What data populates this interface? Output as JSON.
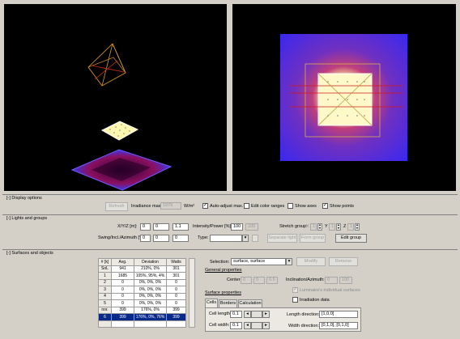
{
  "display_options": {
    "header": "[-] Display options",
    "refresh_label": "Refresh",
    "irradiance_label": "Irradiance max.:",
    "irradiance_value": "1979",
    "irradiance_unit": "W/m²",
    "auto_adjust": {
      "label": "Auto-adjust max.",
      "checked": true
    },
    "edit_color_ranges": {
      "label": "Edit color ranges",
      "checked": false
    },
    "show_axes": {
      "label": "Show axes",
      "checked": false
    },
    "show_points": {
      "label": "Show points",
      "checked": true
    }
  },
  "lights": {
    "header": "[-] Lights and groups",
    "xyz_label": "X/Y/Z [m]:",
    "xyz_values": [
      "0",
      "0",
      "1.1"
    ],
    "intensity_label": "Intensity/Power [%]:",
    "intensity_value": "100",
    "intensity_extra": "100",
    "swing_label": "Swing/Incl./Azimuth [°]:",
    "swing_values": [
      "0",
      "0",
      "0"
    ],
    "type_label": "Type:",
    "type_value": "",
    "stretch_label": "Stretch group:",
    "stretch_x_label": "X",
    "stretch_x_value": "1",
    "stretch_y_label": "Y",
    "stretch_y_value": "1",
    "stretch_z_label": "Z",
    "stretch_z_value": "1",
    "buttons": [
      "Separate light",
      "Form group",
      "Edit group"
    ]
  },
  "surfaces": {
    "header": "[-] Surfaces and objects",
    "table": {
      "headers": [
        "# [k]",
        "Avg.",
        "Deviation",
        "Watts"
      ],
      "rows": [
        [
          "SoL",
          "941",
          "210%, 0%",
          "301"
        ],
        [
          "1",
          "1685",
          "105%, 95%, 4%",
          "301"
        ],
        [
          "2",
          "0",
          "0%, 0%, 0%",
          "0"
        ],
        [
          "3",
          "0",
          "0%, 0%, 0%",
          "0"
        ],
        [
          "4",
          "0",
          "0%, 0%, 0%",
          "0"
        ],
        [
          "5",
          "0",
          "0%, 0%, 0%",
          "0"
        ],
        [
          "nor.",
          "399",
          "176%, 0%",
          "399"
        ],
        [
          "6",
          "399",
          "176%, 0%, 76%",
          "399"
        ]
      ],
      "selected_index": 7
    },
    "selection_label": "Selection:",
    "selection_value": "surface, surface",
    "modify_label": "Modify",
    "remove_label": "Remove",
    "general_properties": "General properties",
    "center_label": "Center:",
    "center_values": [
      "0",
      "0",
      "0.5"
    ],
    "inclination_label": "Inclination/Azimuth:",
    "inclination_values": [
      "0",
      "100"
    ],
    "luminaire_label": "Luminaire's individual surfaces",
    "surface_properties": "Surface properties",
    "irradiation_label": "Irradiation data",
    "tabs": [
      "Cells",
      "Borders",
      "Calculation"
    ],
    "active_tab": 0,
    "cell_length_label": "Cell length:",
    "cell_length_value": "0.1",
    "cell_width_label": "Cell width:",
    "cell_width_value": "0.1",
    "length_direction_label": "Length direction:",
    "length_direction_value": "[1,0,0]",
    "width_direction_label": "Width direction:",
    "width_direction_value": "[0,1,0], [0,1,0]"
  }
}
